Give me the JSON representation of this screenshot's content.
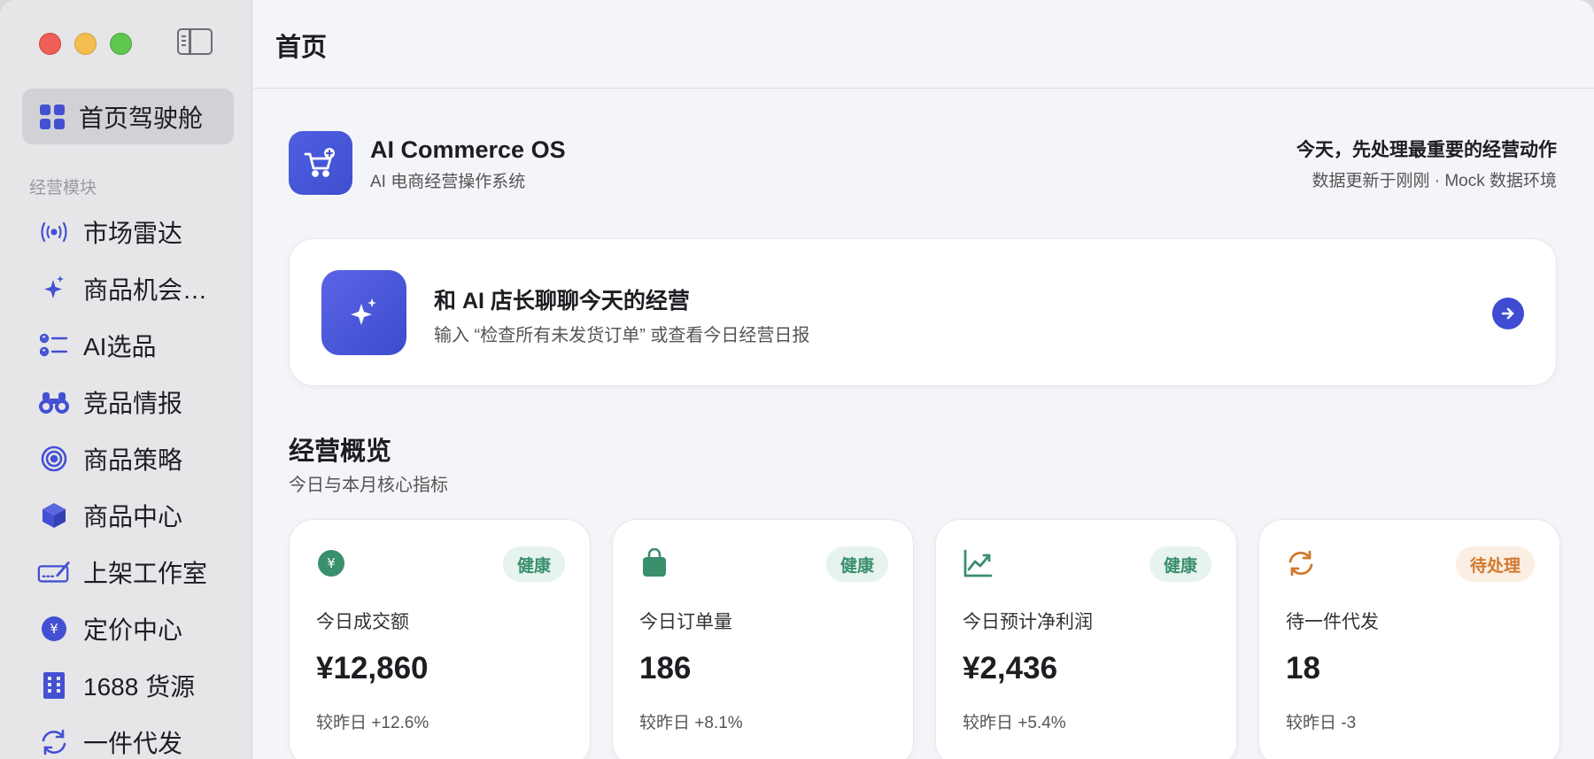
{
  "window": {
    "title": "首页"
  },
  "sidebar": {
    "home_label": "首页驾驶舱",
    "section_label": "经营模块",
    "items": [
      {
        "label": "市场雷达",
        "icon": "radar-icon"
      },
      {
        "label": "商品机会…",
        "icon": "sparkle-icon"
      },
      {
        "label": "AI选品",
        "icon": "checklist-icon"
      },
      {
        "label": "竞品情报",
        "icon": "binoculars-icon"
      },
      {
        "label": "商品策略",
        "icon": "target-icon"
      },
      {
        "label": "商品中心",
        "icon": "box-icon"
      },
      {
        "label": "上架工作室",
        "icon": "signature-icon"
      },
      {
        "label": "定价中心",
        "icon": "yen-circle-icon"
      },
      {
        "label": "1688 货源",
        "icon": "building-icon"
      },
      {
        "label": "一件代发",
        "icon": "sync-icon"
      }
    ]
  },
  "header": {
    "brand_name": "AI Commerce OS",
    "brand_sub": "AI 电商经营操作系统",
    "right_title": "今天，先处理最重要的经营动作",
    "right_sub": "数据更新于刚刚 · Mock 数据环境"
  },
  "chat": {
    "title": "和 AI 店长聊聊今天的经营",
    "subtitle": "输入 “检查所有未发货订单” 或查看今日经营日报"
  },
  "overview": {
    "title": "经营概览",
    "subtitle": "今日与本月核心指标",
    "cards": [
      {
        "label": "今日成交额",
        "value": "¥12,860",
        "delta": "较昨日 +12.6%",
        "badge": "健康",
        "status": "ok",
        "icon": "yen-circle-icon"
      },
      {
        "label": "今日订单量",
        "value": "186",
        "delta": "较昨日 +8.1%",
        "badge": "健康",
        "status": "ok",
        "icon": "bag-icon"
      },
      {
        "label": "今日预计净利润",
        "value": "¥2,436",
        "delta": "较昨日 +5.4%",
        "badge": "健康",
        "status": "ok",
        "icon": "trend-chart-icon"
      },
      {
        "label": "待一件代发",
        "value": "18",
        "delta": "较昨日 -3",
        "badge": "待处理",
        "status": "warn",
        "icon": "sync-icon"
      }
    ]
  },
  "colors": {
    "accent": "#4450d2",
    "ok": "#3a8f6c",
    "warn": "#d07a2e"
  }
}
